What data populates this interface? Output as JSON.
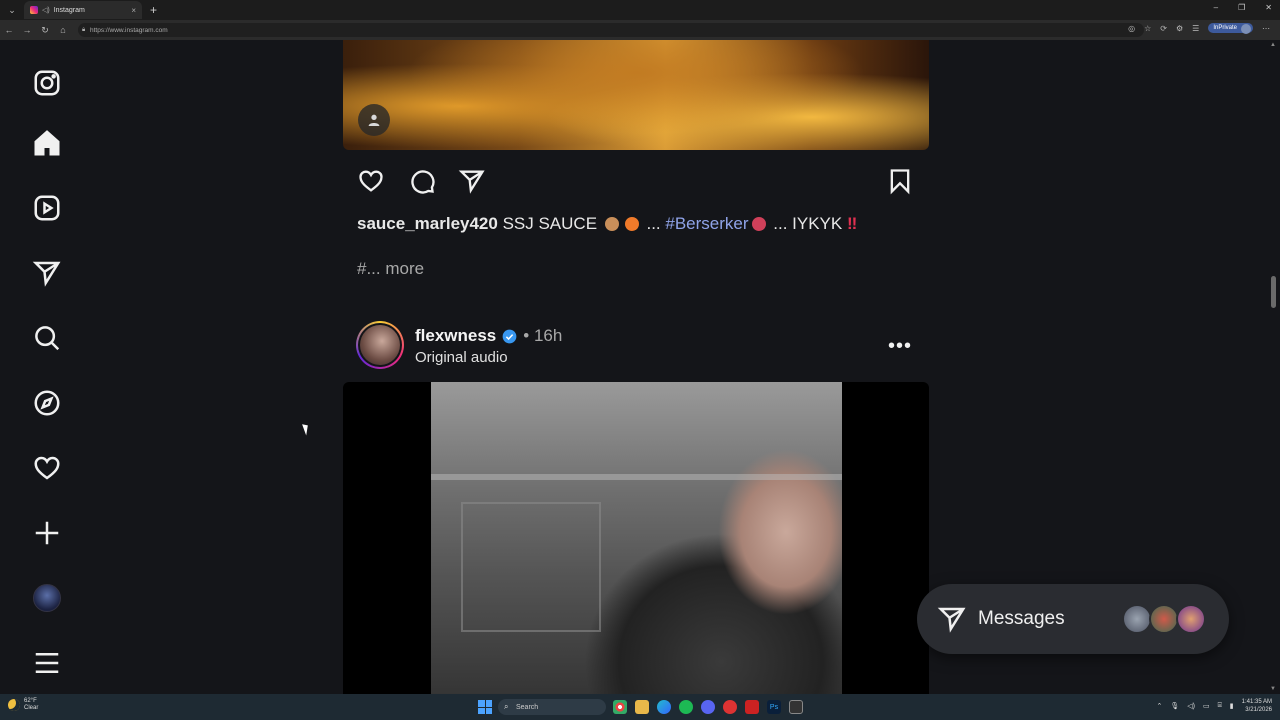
{
  "browser": {
    "tab_title": "Instagram",
    "tab_close": "×",
    "new_tab": "+",
    "url": "https://www.instagram.com",
    "inprivate_label": "InPrivate",
    "window_controls": [
      "–",
      "❐",
      "✕"
    ]
  },
  "sidebar": {
    "items": [
      {
        "name": "instagram-logo-icon"
      },
      {
        "name": "home-icon"
      },
      {
        "name": "reels-icon"
      },
      {
        "name": "direct-icon"
      },
      {
        "name": "search-icon"
      },
      {
        "name": "explore-icon"
      },
      {
        "name": "notifications-icon"
      },
      {
        "name": "create-icon"
      },
      {
        "name": "profile-avatar"
      },
      {
        "name": "menu-icon"
      }
    ]
  },
  "post1": {
    "username": "sauce_marley420",
    "caption_text": " SSJ SAUCE ",
    "caption_mid": " ... ",
    "hashtag": "#Berserker",
    "caption_end": " ... IYKYK ",
    "more_prefix": "#...",
    "more_label": " more"
  },
  "post2": {
    "username": "flexwness",
    "time": "• 16h",
    "audio": "Original audio",
    "more_dots": "•••"
  },
  "messages": {
    "label": "Messages"
  },
  "taskbar": {
    "weather_temp": "62°F",
    "weather_cond": "Clear",
    "search_placeholder": "Search",
    "time": "1:41:35 AM",
    "date": "3/21/2026"
  },
  "colors": {
    "page_bg": "#141519",
    "hashtag": "#8fa3e8",
    "taskbar_bg": "#1e2a33",
    "inprivate_bg": "#3d5a9c"
  }
}
